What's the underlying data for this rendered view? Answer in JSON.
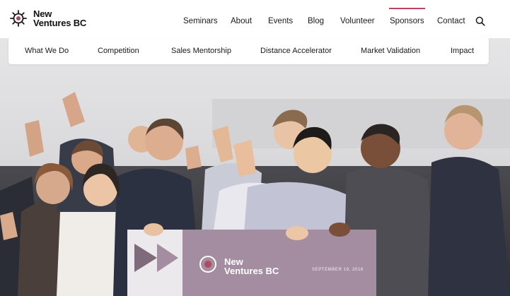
{
  "brand": {
    "line1": "New",
    "line2": "Ventures BC",
    "accent": "#b5475e"
  },
  "main_nav": [
    {
      "label": "Seminars"
    },
    {
      "label": "About"
    },
    {
      "label": "Events"
    },
    {
      "label": "Blog"
    },
    {
      "label": "Volunteer"
    },
    {
      "label": "Sponsors",
      "active": true
    },
    {
      "label": "Contact"
    }
  ],
  "sub_nav": [
    {
      "label": "What We Do"
    },
    {
      "label": "Competition"
    },
    {
      "label": "Sales Mentorship"
    },
    {
      "label": "Distance Accelerator"
    },
    {
      "label": "Market Validation"
    },
    {
      "label": "Impact"
    }
  ],
  "hero": {
    "check_line1": "New",
    "check_line2": "Ventures BC",
    "check_date": "SEPTEMBER 19, 2018",
    "check_color": "#9a8298"
  },
  "icons": {
    "search": "search-icon",
    "logo": "logo-mark-icon"
  }
}
